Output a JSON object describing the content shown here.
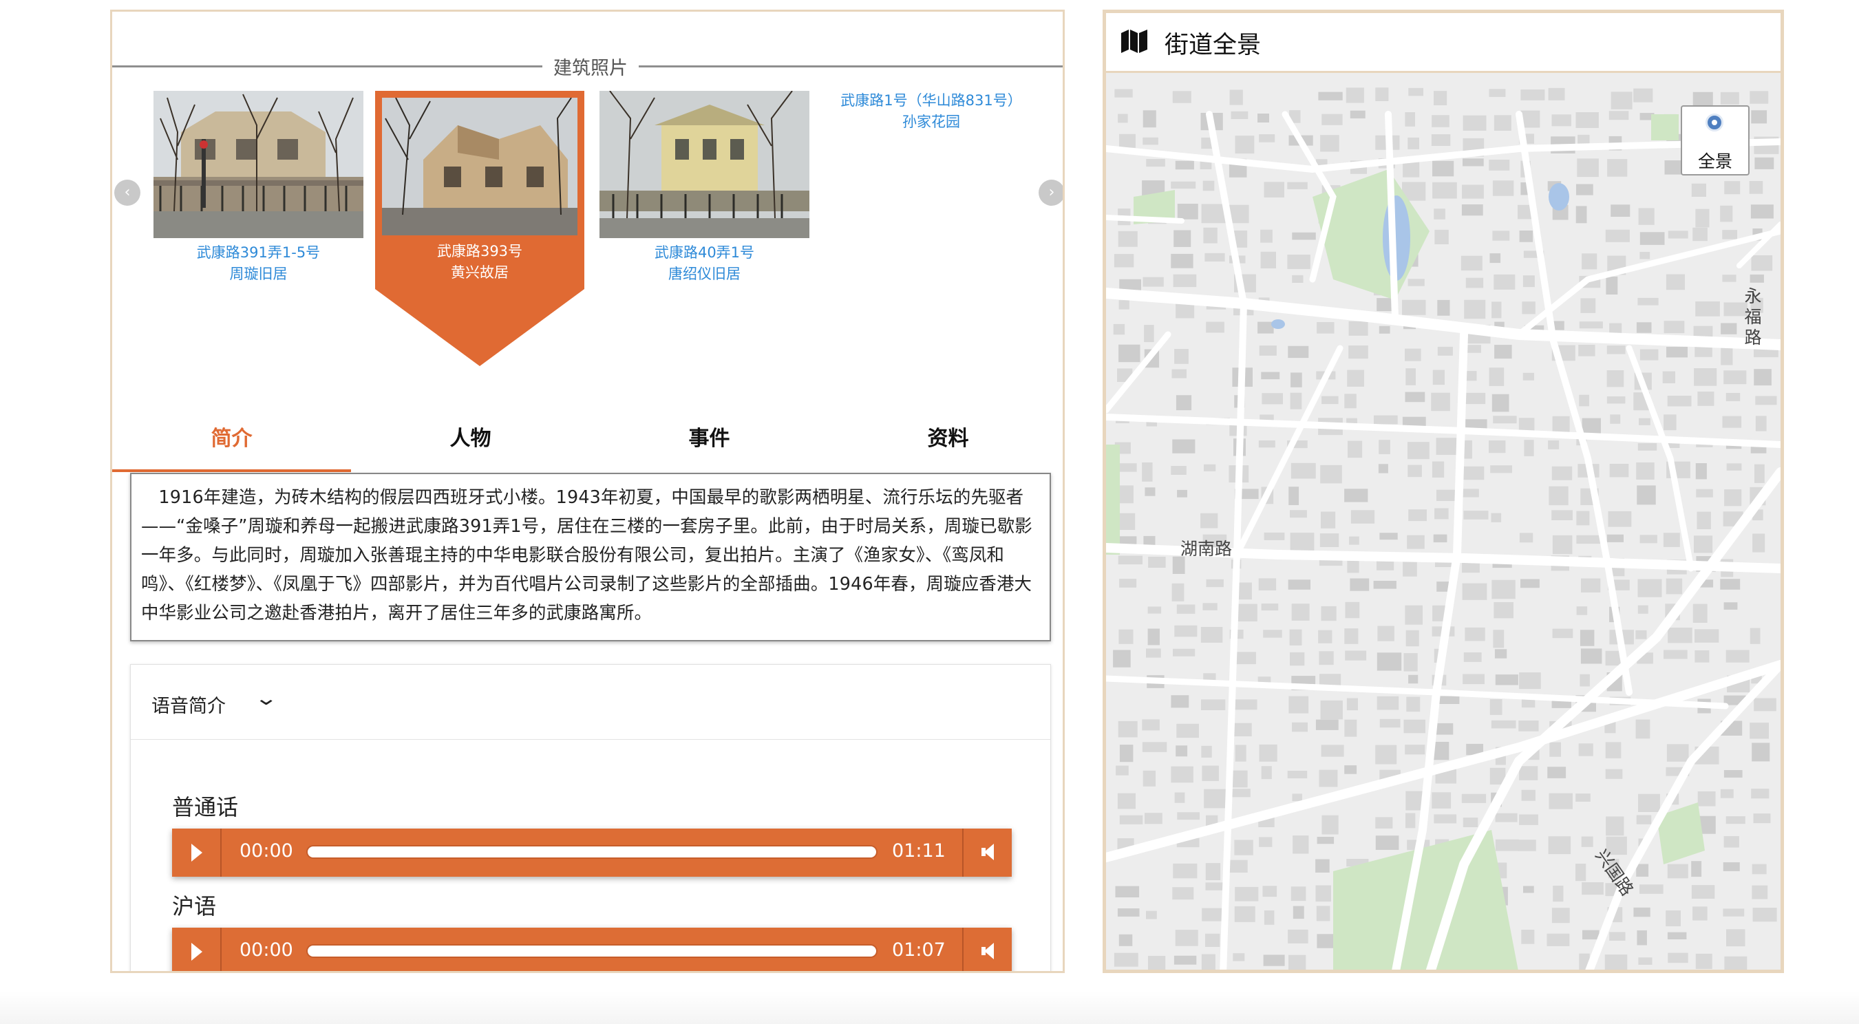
{
  "photos": {
    "heading": "建筑照片",
    "items": [
      {
        "line1": "武康路391弄1-5号",
        "line2": "周璇旧居"
      },
      {
        "line1": "武康路393号",
        "line2": "黄兴故居"
      },
      {
        "line1": "武康路40弄1号",
        "line2": "唐绍仪旧居"
      },
      {
        "line1": "武康路1号（华山路831号）",
        "line2": "孙家花园"
      }
    ],
    "active_index": 1
  },
  "tabs": [
    "简介",
    "人物",
    "事件",
    "资料"
  ],
  "active_tab": "简介",
  "intro": "1916年建造，为砖木结构的假层四西班牙式小楼。1943年初夏，中国最早的歌影两栖明星、流行乐坛的先驱者——“金嗓子”周璇和养母一起搬进武康路391弄1号，居住在三楼的一套房子里。此前，由于时局关系，周璇已歇影一年多。与此同时，周璇加入张善琨主持的中华电影联合股份有限公司，复出拍片。主演了《渔家女》、《鸾凤和鸣》、《红楼梦》、《凤凰于飞》四部影片，并为百代唱片公司录制了这些影片的全部插曲。1946年春，周璇应香港大中华影业公司之邀赴香港拍片，离开了居住三年多的武康路寓所。",
  "audio": {
    "header": "语音简介",
    "tracks": [
      {
        "language": "普通话",
        "current": "00:00",
        "duration": "01:11",
        "progress": 0
      },
      {
        "language": "沪语",
        "current": "00:00",
        "duration": "01:07",
        "progress": 0
      }
    ]
  },
  "map": {
    "title": "街道全景",
    "panorama_button": "全景",
    "street_labels": [
      "永福路",
      "湖南路",
      "兴国路"
    ]
  },
  "colors": {
    "accent": "#e06a33",
    "player": "#dd6d35",
    "panel_border": "#e8d6bd",
    "link": "#2e8ad8",
    "map_bg": "#ededed",
    "map_building": "#d6d6d6",
    "map_road": "#ffffff",
    "map_park": "#cfe6c4",
    "map_water": "#a9c5e8"
  }
}
